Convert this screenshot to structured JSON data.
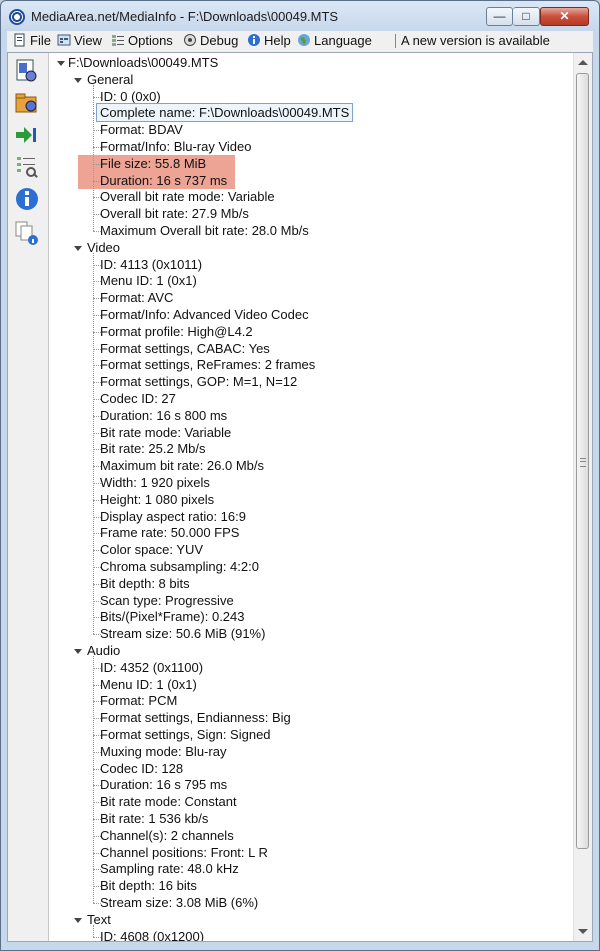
{
  "window": {
    "title": "MediaArea.net/MediaInfo - F:\\Downloads\\00049.MTS"
  },
  "menu": {
    "file": "File",
    "view": "View",
    "options": "Options",
    "debug": "Debug",
    "help": "Help",
    "language": "Language",
    "notice": "A new version is available"
  },
  "tree": {
    "root": "F:\\Downloads\\00049.MTS",
    "sections": [
      {
        "title": "General",
        "items": [
          "ID: 0 (0x0)",
          "Complete name: F:\\Downloads\\00049.MTS",
          "Format: BDAV",
          "Format/Info: Blu-ray Video",
          "File size: 55.8 MiB",
          "Duration: 16 s 737 ms",
          "Overall bit rate mode: Variable",
          "Overall bit rate: 27.9 Mb/s",
          "Maximum Overall bit rate: 28.0 Mb/s"
        ]
      },
      {
        "title": "Video",
        "items": [
          "ID: 4113 (0x1011)",
          "Menu ID: 1 (0x1)",
          "Format: AVC",
          "Format/Info: Advanced Video Codec",
          "Format profile: High@L4.2",
          "Format settings, CABAC: Yes",
          "Format settings, ReFrames: 2 frames",
          "Format settings, GOP: M=1, N=12",
          "Codec ID: 27",
          "Duration: 16 s 800 ms",
          "Bit rate mode: Variable",
          "Bit rate: 25.2 Mb/s",
          "Maximum bit rate: 26.0 Mb/s",
          "Width: 1 920 pixels",
          "Height: 1 080 pixels",
          "Display aspect ratio: 16:9",
          "Frame rate: 50.000 FPS",
          "Color space: YUV",
          "Chroma subsampling: 4:2:0",
          "Bit depth: 8 bits",
          "Scan type: Progressive",
          "Bits/(Pixel*Frame): 0.243",
          "Stream size: 50.6 MiB (91%)"
        ]
      },
      {
        "title": "Audio",
        "items": [
          "ID: 4352 (0x1100)",
          "Menu ID: 1 (0x1)",
          "Format: PCM",
          "Format settings, Endianness: Big",
          "Format settings, Sign: Signed",
          "Muxing mode: Blu-ray",
          "Codec ID: 128",
          "Duration: 16 s 795 ms",
          "Bit rate mode: Constant",
          "Bit rate: 1 536 kb/s",
          "Channel(s): 2 channels",
          "Channel positions: Front: L R",
          "Sampling rate: 48.0 kHz",
          "Bit depth: 16 bits",
          "Stream size: 3.08 MiB (6%)"
        ]
      },
      {
        "title": "Text",
        "items": [
          "ID: 4608 (0x1200)"
        ]
      }
    ]
  }
}
